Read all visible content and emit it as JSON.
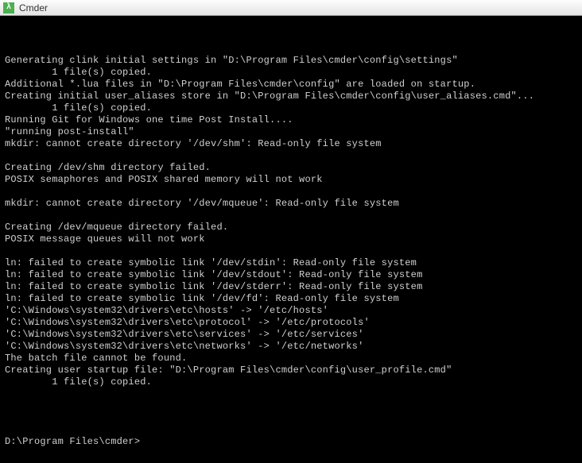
{
  "window": {
    "title": "Cmder",
    "icon_glyph": "λ"
  },
  "terminal": {
    "lines": [
      "",
      "Generating clink initial settings in \"D:\\Program Files\\cmder\\config\\settings\"",
      "        1 file(s) copied.",
      "Additional *.lua files in \"D:\\Program Files\\cmder\\config\" are loaded on startup.",
      "Creating initial user_aliases store in \"D:\\Program Files\\cmder\\config\\user_aliases.cmd\"...",
      "        1 file(s) copied.",
      "Running Git for Windows one time Post Install....",
      "\"running post-install\"",
      "mkdir: cannot create directory '/dev/shm': Read-only file system",
      "",
      "Creating /dev/shm directory failed.",
      "POSIX semaphores and POSIX shared memory will not work",
      "",
      "mkdir: cannot create directory '/dev/mqueue': Read-only file system",
      "",
      "Creating /dev/mqueue directory failed.",
      "POSIX message queues will not work",
      "",
      "ln: failed to create symbolic link '/dev/stdin': Read-only file system",
      "ln: failed to create symbolic link '/dev/stdout': Read-only file system",
      "ln: failed to create symbolic link '/dev/stderr': Read-only file system",
      "ln: failed to create symbolic link '/dev/fd': Read-only file system",
      "'C:\\Windows\\system32\\drivers\\etc\\hosts' -> '/etc/hosts'",
      "'C:\\Windows\\system32\\drivers\\etc\\protocol' -> '/etc/protocols'",
      "'C:\\Windows\\system32\\drivers\\etc\\services' -> '/etc/services'",
      "'C:\\Windows\\system32\\drivers\\etc\\networks' -> '/etc/networks'",
      "The batch file cannot be found.",
      "Creating user startup file: \"D:\\Program Files\\cmder\\config\\user_profile.cmd\"",
      "        1 file(s) copied.",
      "",
      ""
    ],
    "prompt": "D:\\Program Files\\cmder>",
    "input_value": ""
  }
}
